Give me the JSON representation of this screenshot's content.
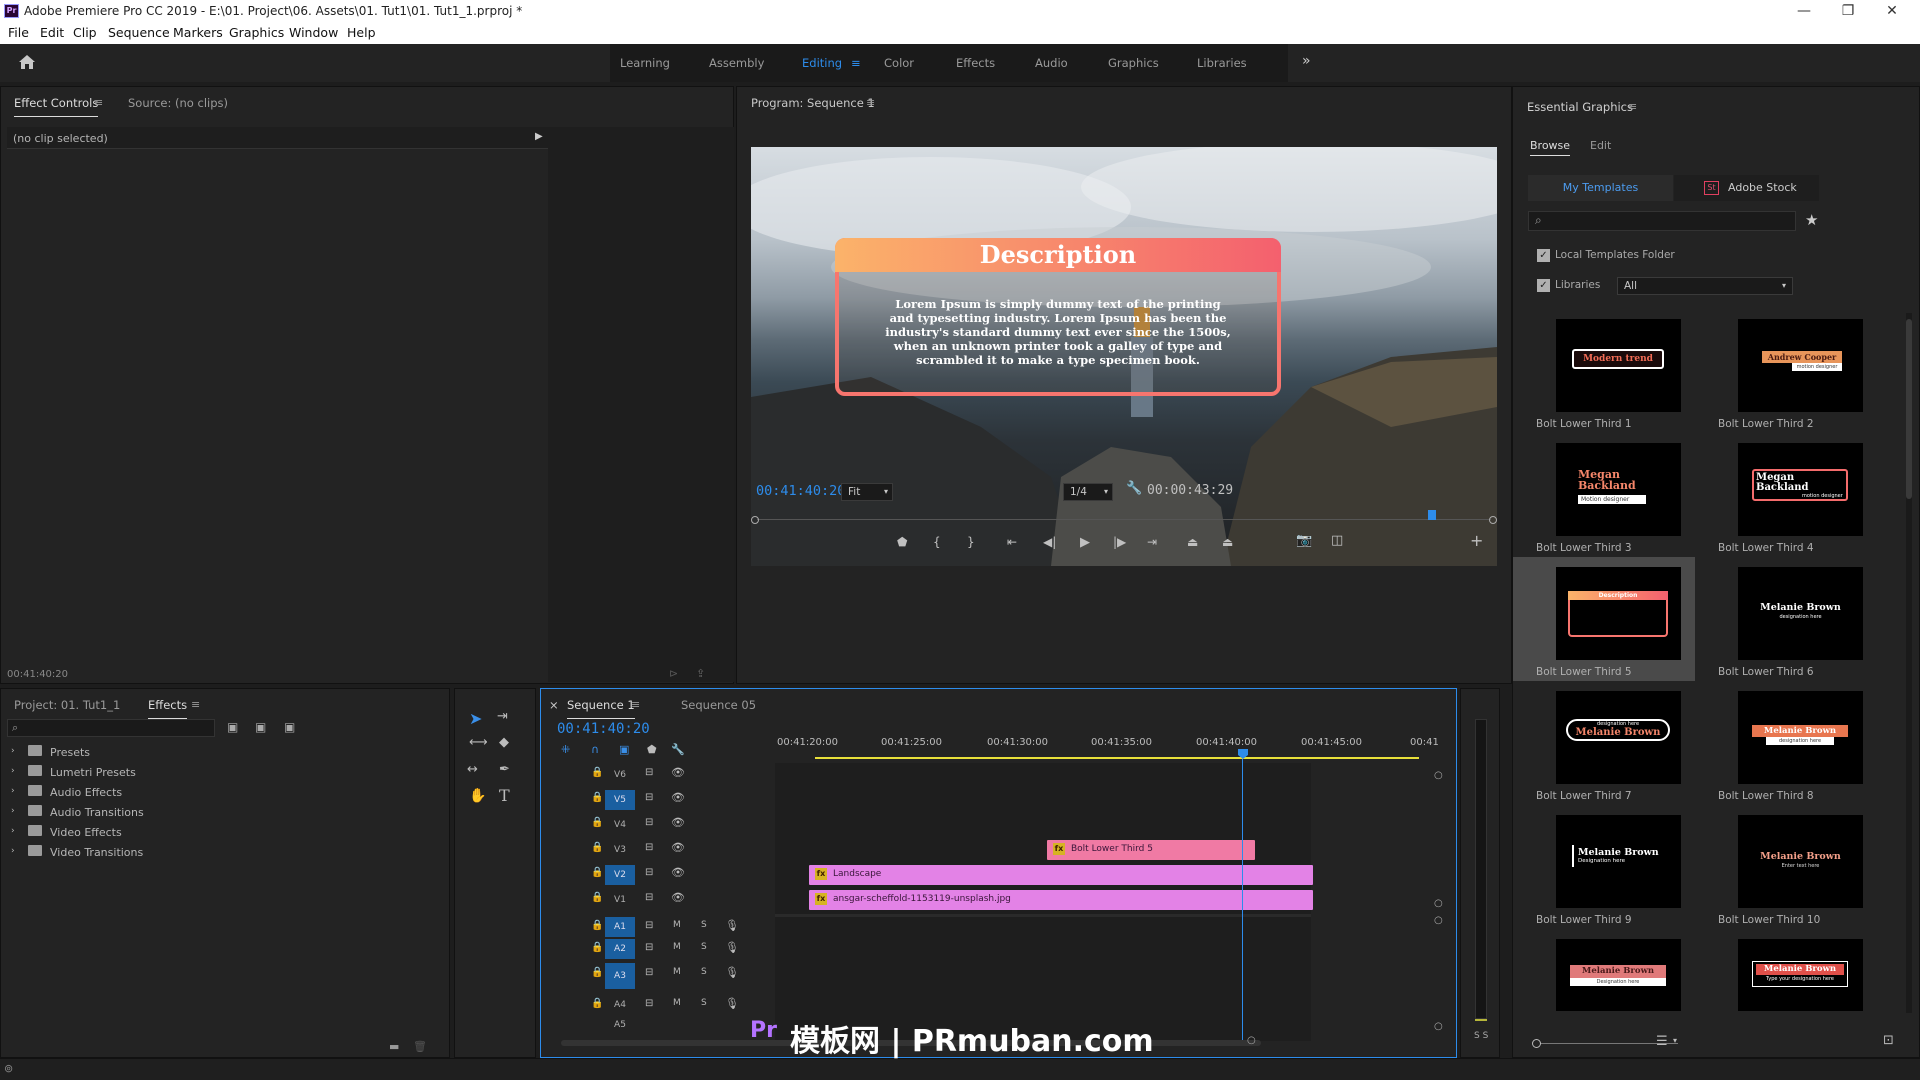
{
  "app": {
    "logo": "Pr",
    "window_title": "Adobe Premiere Pro CC 2019 - E:\\01. Project\\06. Assets\\01. Tut1\\01. Tut1_1.prproj *",
    "minimize": "—",
    "maximize": "❐",
    "close": "✕"
  },
  "menu": [
    "File",
    "Edit",
    "Clip",
    "Sequence",
    "Markers",
    "Graphics",
    "Window",
    "Help"
  ],
  "workspaces": [
    "Learning",
    "Assembly",
    "Editing",
    "Color",
    "Effects",
    "Audio",
    "Graphics",
    "Libraries"
  ],
  "workspace_active": "Editing",
  "workspace_more": "»",
  "effect_controls": {
    "tab": "Effect Controls",
    "source_tab": "Source: (no clips)",
    "no_clip": "(no clip selected)",
    "footer_timecode": "00:41:40:20"
  },
  "program": {
    "tab": "Program: Sequence 1",
    "overlay_title": "Description",
    "overlay_body": "Lorem Ipsum is simply dummy text of the printing and typesetting industry. Lorem Ipsum has been the industry's standard dummy text ever since the 1500s, when an unknown printer took a galley of type and scrambled it to make a type specimen book.",
    "timecode_current": "00:41:40:20",
    "zoom": "Fit",
    "resolution": "1/4",
    "timecode_duration": "00:00:43:29",
    "playhead_fraction": 0.92
  },
  "project": {
    "tab_project": "Project: 01. Tut1_1",
    "tab_effects": "Effects",
    "folders": [
      "Presets",
      "Lumetri Presets",
      "Audio Effects",
      "Audio Transitions",
      "Video Effects",
      "Video Transitions"
    ]
  },
  "timeline": {
    "tab_active": "Sequence 1",
    "tab_other": "Sequence 05",
    "close_x": "×",
    "timecode": "00:41:40:20",
    "ruler": [
      "00:41:20:00",
      "00:41:25:00",
      "00:41:30:00",
      "00:41:35:00",
      "00:41:40:00",
      "00:41:45:00",
      "00:41"
    ],
    "video_tracks": [
      "V6",
      "V5",
      "V4",
      "V3",
      "V2",
      "V1"
    ],
    "audio_tracks": [
      "A1",
      "A2",
      "A3",
      "A4",
      "A5"
    ],
    "clips": {
      "v3": "Bolt Lower Third 5",
      "v2": "Landscape",
      "v1": "ansgar-scheffold-1153119-unsplash.jpg"
    },
    "mute_label": "M",
    "solo_label": "S",
    "meter_labels": "S S"
  },
  "essential_graphics": {
    "title": "Essential Graphics",
    "tab_browse": "Browse",
    "tab_edit": "Edit",
    "btn_my_templates": "My Templates",
    "btn_adobe_stock": "Adobe Stock",
    "stock_badge": "St",
    "check_local": "Local Templates Folder",
    "check_libraries": "Libraries",
    "libraries_value": "All",
    "templates": [
      {
        "label": "Bolt Lower Third 1",
        "thumb_text": "Modern trend",
        "sub": ""
      },
      {
        "label": "Bolt Lower Third 2",
        "thumb_text": "Andrew Cooper",
        "sub": "motion designer"
      },
      {
        "label": "Bolt Lower Third 3",
        "thumb_text": "Megan Backland",
        "sub": "Motion designer"
      },
      {
        "label": "Bolt Lower Third 4",
        "thumb_text": "Megan Backland",
        "sub": "motion designer"
      },
      {
        "label": "Bolt Lower Third 5",
        "thumb_text": "Description",
        "sub": ""
      },
      {
        "label": "Bolt Lower Third 6",
        "thumb_text": "Melanie Brown",
        "sub": "designation here"
      },
      {
        "label": "Bolt Lower Third 7",
        "thumb_text": "Melanie Brown",
        "sub": "designation here"
      },
      {
        "label": "Bolt Lower Third 8",
        "thumb_text": "Melanie Brown",
        "sub": "designation here"
      },
      {
        "label": "Bolt Lower Third 9",
        "thumb_text": "Melanie Brown",
        "sub": "Designation here"
      },
      {
        "label": "Bolt Lower Third 10",
        "thumb_text": "Melanie Brown",
        "sub": "Enter text here"
      },
      {
        "label": "",
        "thumb_text": "Melanie Brown",
        "sub": "Designation here"
      },
      {
        "label": "",
        "thumb_text": "Melanie Brown",
        "sub": "Type your designation here"
      }
    ]
  },
  "watermark": {
    "badge": "Pr",
    "text": "模板网 | PRmuban.com"
  },
  "colors": {
    "accent_blue": "#2d8ceb",
    "clip_pink": "#e382e6",
    "clip_rose": "#f07aa4",
    "overlay_gradient_start": "#fbb36a",
    "overlay_gradient_end": "#f4606e"
  }
}
